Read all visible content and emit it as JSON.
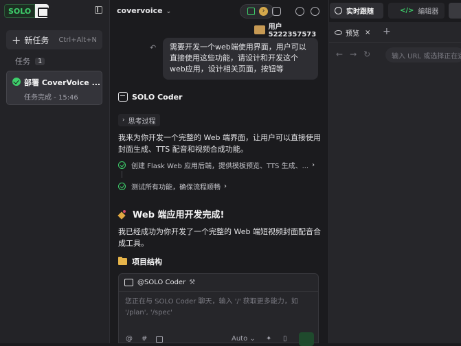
{
  "sidebar": {
    "logo_text": "SOLO",
    "new_task_label": "新任务",
    "new_task_shortcut": "Ctrl+Alt+N",
    "tasks_label": "任务",
    "tasks_count": "1",
    "task": {
      "title": "部署 CoverVoice ...",
      "status": "任务完成 - 15:46"
    }
  },
  "header": {
    "project": "covervoice"
  },
  "chat": {
    "user_name": "用户5222357573",
    "user_message": "需要开发一个web端使用界面，用户可以直接使用这些功能，请设计和开发这个web应用，设计相关页面，按钮等",
    "agent_name": "SOLO Coder",
    "thinking_label": "思考过程",
    "intro": "我来为你开发一个完整的 Web 端界面，让用户可以直接使用封面生成、TTS 配音和视频合成功能。",
    "steps": [
      {
        "label": "创建 Flask Web 应用后端，提供模板预览、TTS 生成、..."
      },
      {
        "label": "测试所有功能，确保流程顺畅"
      }
    ],
    "done_heading": "Web 端应用开发完成!",
    "done_text": "我已经成功为你开发了一个完整的 Web 端短视频封面配音合成工具。",
    "structure_heading": "项目结构"
  },
  "composer": {
    "mention": "@SOLO Coder",
    "placeholder": "您正在与 SOLO Coder 聊天，输入 '/' 获取更多能力，如 '/plan', '/spec'",
    "at": "@",
    "hash": "#",
    "mode": "Auto"
  },
  "right": {
    "tab_live": "实时跟随",
    "tab_editor": "编辑器",
    "preview_tab": "预览",
    "close_glyph": "×",
    "url_placeholder": "输入 URL 或选择正在运行"
  },
  "colors": {
    "accent": "#3ecf6b",
    "background": "#1b1b1e",
    "panel": "#232327"
  }
}
